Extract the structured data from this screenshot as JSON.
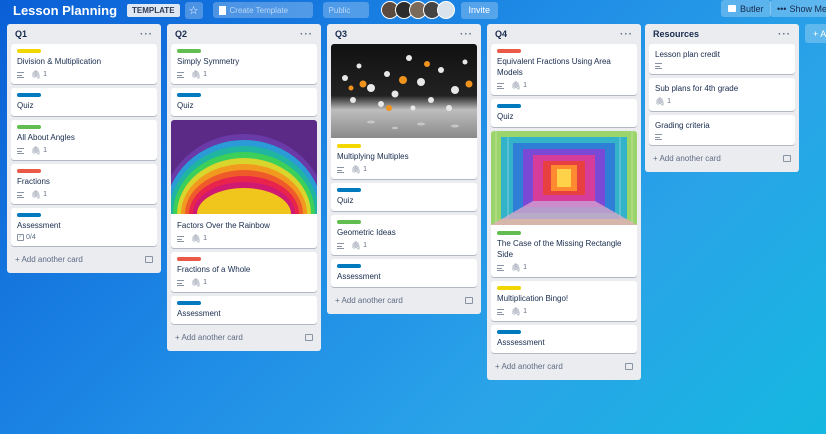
{
  "topbar": {
    "board_title": "Lesson Planning",
    "template_badge": "TEMPLATE",
    "star": "☆",
    "faded_button_1": "Create Template",
    "faded_button_2": "Public",
    "invite": "Invite",
    "butler": "Butler",
    "show_menu": "Show Menu"
  },
  "add_another_card": "Add another card",
  "add_list": "+ A",
  "lists": [
    {
      "title": "Q1",
      "cards": [
        {
          "label_color": "#f2d600",
          "title": "Division & Multiplication",
          "desc": true,
          "attachments": "1"
        },
        {
          "label_color": "#0079bf",
          "title": "Quiz"
        },
        {
          "label_color": "#61bd4f",
          "title": "All About Angles",
          "desc": true,
          "attachments": "1"
        },
        {
          "label_color": "#eb5a46",
          "title": "Fractions",
          "desc": true,
          "attachments": "1"
        },
        {
          "label_color": "#0079bf",
          "title": "Assessment",
          "checklist": "0/4"
        }
      ]
    },
    {
      "title": "Q2",
      "cards": [
        {
          "label_color": "#61bd4f",
          "title": "Simply Symmetry",
          "desc": true,
          "attachments": "1"
        },
        {
          "label_color": "#0079bf",
          "title": "Quiz"
        },
        {
          "cover": "rainbow",
          "title": "Factors Over the Rainbow",
          "desc": true,
          "attachments": "1"
        },
        {
          "label_color": "#eb5a46",
          "title": "Fractions of a Whole",
          "desc": true,
          "attachments": "1"
        },
        {
          "label_color": "#0079bf",
          "title": "Assessment"
        }
      ]
    },
    {
      "title": "Q3",
      "cards": [
        {
          "cover": "balls",
          "label_color": "#f2d600",
          "title": "Multiplying Multiples",
          "desc": true,
          "attachments": "1"
        },
        {
          "label_color": "#0079bf",
          "title": "Quiz"
        },
        {
          "label_color": "#61bd4f",
          "title": "Geometric Ideas",
          "desc": true,
          "attachments": "1"
        },
        {
          "label_color": "#0079bf",
          "title": "Assessment"
        }
      ]
    },
    {
      "title": "Q4",
      "cards": [
        {
          "label_color": "#eb5a46",
          "title": "Equivalent Fractions Using Area Models",
          "desc": true,
          "attachments": "1"
        },
        {
          "label_color": "#0079bf",
          "title": "Quiz"
        },
        {
          "cover": "tunnel",
          "label_color": "#61bd4f",
          "title": "The Case of the Missing Rectangle Side",
          "desc": true,
          "attachments": "1"
        },
        {
          "label_color": "#f2d600",
          "title": "Multiplication Bingo!",
          "desc": true,
          "attachments": "1"
        },
        {
          "label_color": "#0079bf",
          "title": "Asssessment"
        }
      ]
    },
    {
      "title": "Resources",
      "cards": [
        {
          "title": "Lesson plan credit",
          "desc": true
        },
        {
          "title": "Sub plans for 4th grade",
          "attachments": "1"
        },
        {
          "title": "Grading criteria",
          "desc": true
        }
      ]
    }
  ]
}
